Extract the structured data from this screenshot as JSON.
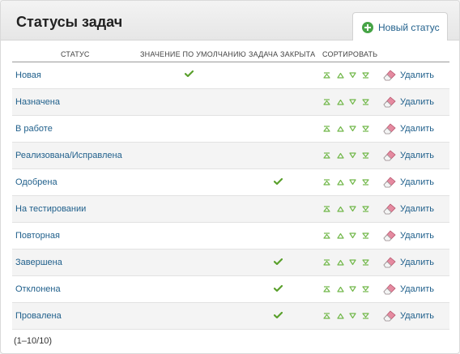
{
  "header": {
    "title": "Статусы задач",
    "new_status_label": "Новый статус"
  },
  "table": {
    "columns": {
      "status": "Статус",
      "default": "Значение по умолчанию",
      "closed": "Задача закрыта",
      "sort": "Сортировать"
    },
    "delete_label": "Удалить",
    "rows": [
      {
        "name": "Новая",
        "is_default": true,
        "is_closed": false
      },
      {
        "name": "Назначена",
        "is_default": false,
        "is_closed": false
      },
      {
        "name": "В работе",
        "is_default": false,
        "is_closed": false
      },
      {
        "name": "Реализована/Исправлена",
        "is_default": false,
        "is_closed": false
      },
      {
        "name": "Одобрена",
        "is_default": false,
        "is_closed": true
      },
      {
        "name": "На тестировании",
        "is_default": false,
        "is_closed": false
      },
      {
        "name": "Повторная",
        "is_default": false,
        "is_closed": false
      },
      {
        "name": "Завершена",
        "is_default": false,
        "is_closed": true
      },
      {
        "name": "Отклонена",
        "is_default": false,
        "is_closed": true
      },
      {
        "name": "Провалена",
        "is_default": false,
        "is_closed": true
      }
    ]
  },
  "pagination": "(1–10/10)",
  "icons": {
    "new": "plus-circle-icon",
    "check": "checkmark-icon",
    "sort": [
      "move-to-top-icon",
      "move-up-icon",
      "move-down-icon",
      "move-to-bottom-icon"
    ],
    "delete": "eraser-icon"
  },
  "colors": {
    "link": "#1f5f8b",
    "check": "#5aa02c",
    "sort_arrow": "#72b84a",
    "eraser": "#e58aa0"
  }
}
